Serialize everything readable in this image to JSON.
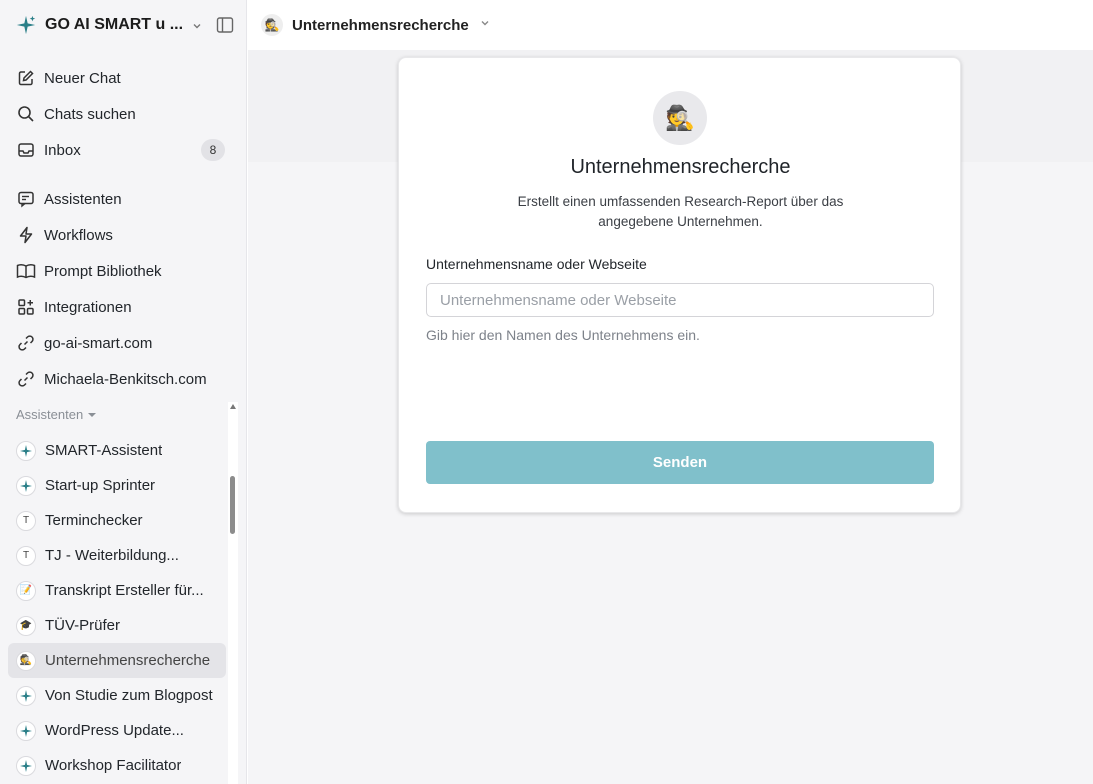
{
  "sidebar": {
    "workspace_name": "GO AI SMART u ...",
    "nav": [
      {
        "label": "Neuer Chat",
        "icon": "edit-icon"
      },
      {
        "label": "Chats suchen",
        "icon": "search-icon"
      },
      {
        "label": "Inbox",
        "icon": "inbox-icon",
        "badge": "8"
      }
    ],
    "nav2": [
      {
        "label": "Assistenten",
        "icon": "assistants-icon"
      },
      {
        "label": "Workflows",
        "icon": "lightning-icon"
      },
      {
        "label": "Prompt Bibliothek",
        "icon": "book-icon"
      },
      {
        "label": "Integrationen",
        "icon": "grid-icon"
      },
      {
        "label": "go-ai-smart.com",
        "icon": "link-icon"
      },
      {
        "label": "Michaela-Benkitsch.com",
        "icon": "link-icon"
      }
    ],
    "section_label": "Assistenten",
    "assistants": [
      {
        "label": "SMART-Assistent",
        "avatar": "sparkle"
      },
      {
        "label": "Start-up Sprinter",
        "avatar": "sparkle"
      },
      {
        "label": "Terminchecker",
        "avatar": "T"
      },
      {
        "label": "TJ - Weiterbildung...",
        "avatar": "T"
      },
      {
        "label": "Transkript Ersteller für...",
        "avatar": "📝"
      },
      {
        "label": "TÜV-Prüfer",
        "avatar": "🎓"
      },
      {
        "label": "Unternehmensrecherche",
        "avatar": "🕵️",
        "active": true
      },
      {
        "label": "Von Studie zum Blogpost",
        "avatar": "sparkle"
      },
      {
        "label": "WordPress Update...",
        "avatar": "sparkle"
      },
      {
        "label": "Workshop Facilitator",
        "avatar": "sparkle"
      }
    ]
  },
  "topbar": {
    "title": "Unternehmensrecherche",
    "avatar": "🕵️"
  },
  "card": {
    "avatar": "🕵️",
    "title": "Unternehmensrecherche",
    "description": "Erstellt einen umfassenden Research-Report über das angegebene Unternehmen.",
    "field_label": "Unternehmensname oder Webseite",
    "field_placeholder": "Unternehmensname oder Webseite",
    "field_value": "",
    "field_hint": "Gib hier den Namen des Unternehmens ein.",
    "submit_label": "Senden"
  },
  "colors": {
    "accent": "#2a8c96",
    "button": "#80c0cb"
  }
}
